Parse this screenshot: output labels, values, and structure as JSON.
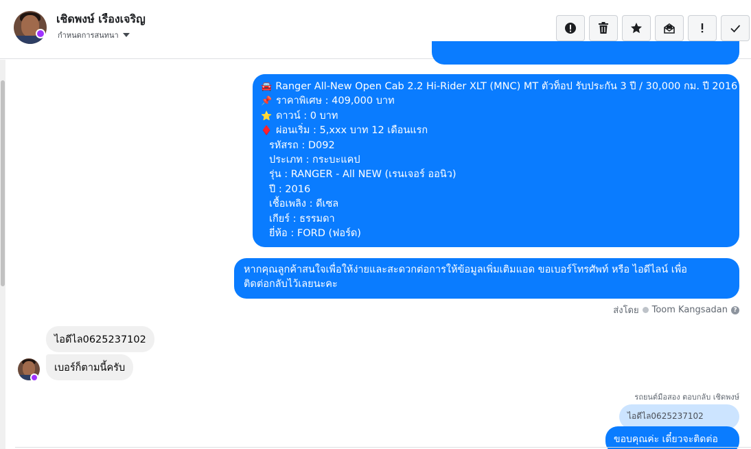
{
  "contact": {
    "name": "เชิดพงษ์ เรืองเจริญ",
    "subtitle": "กำหนดการสนทนา"
  },
  "toolbar": {
    "buttons": [
      "spam-icon",
      "trash-icon",
      "star-icon",
      "mark-unread-icon",
      "important-icon",
      "done-icon"
    ]
  },
  "messages": {
    "listing": {
      "lines": [
        {
          "icon": "car-icon",
          "glyph": "🚘",
          "text": "Ranger All-New Open Cab 2.2 Hi-Rider XLT (MNC) MT ตัวท็อป รับประกัน 3 ปี / 30,000 กม. ปี 2016"
        },
        {
          "icon": "pin-icon",
          "glyph": "📌",
          "text": "ราคาพิเศษ : 409,000 บาท"
        },
        {
          "icon": "star-icon",
          "glyph": "⭐",
          "text": "ดาวน์ : 0 บาท"
        },
        {
          "icon": "diamond-icon",
          "glyph": "♦️",
          "text": "ผ่อนเริ่ม : 5,xxx บาท 12 เดือนแรก"
        }
      ],
      "details": [
        "รหัสรถ : D092",
        "ประเภท : กระบะแคป",
        "รุ่น : RANGER - All NEW (เรนเจอร์ ออนิว)",
        "ปี : 2016",
        "เชื้อเพลิง : ดีเซล",
        "เกียร์ : ธรรมดา",
        "ยี่ห้อ : FORD (ฟอร์ด)"
      ]
    },
    "offer": {
      "line1": "หากคุณลูกค้าสนใจเพื่อให้ง่ายและสะดวกต่อการให้ข้อมูลเพิ่มเติมแอด ขอเบอร์โทรศัพท์ หรือ ไอดีไลน์ เพื่อ",
      "line2": "ติดต่อกลับไว้เลยนะคะ"
    },
    "sent_by_label": "ส่งโดย",
    "sent_by_name": "Toom Kangsadan",
    "incoming": [
      "ไอดีไล0625237102",
      "เบอร์ก็ตามนี้ครับ"
    ],
    "reply_meta": "รถยนต์มือสอง ตอบกลับ เชิดพงษ์",
    "reply_quote": "ไอดีไล0625237102",
    "reply_text": "ขอบคุณค่ะ เดี๋ยวจะติดต่อกลับนะคะ"
  },
  "colors": {
    "outgoing_bubble": "#0a7cff",
    "incoming_bubble": "#f0f0f0",
    "quote_bubble": "#cce4ff"
  }
}
